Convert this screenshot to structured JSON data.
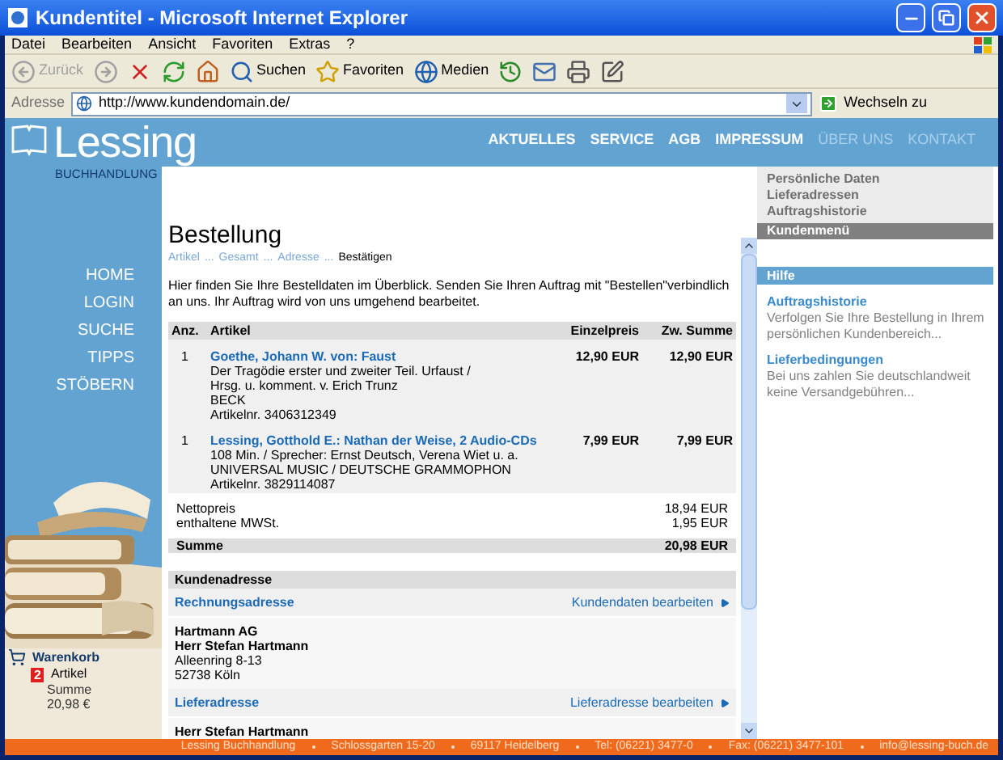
{
  "window": {
    "title": "Kundentitel - Microsoft Internet Explorer"
  },
  "menu": [
    "Datei",
    "Bearbeiten",
    "Ansicht",
    "Favoriten",
    "Extras",
    "?"
  ],
  "toolbar": [
    {
      "kind": "back",
      "label": "Zurück",
      "disabled": true
    },
    {
      "kind": "forward",
      "disabled": true
    },
    {
      "kind": "stop",
      "disabled": false
    },
    {
      "kind": "refresh",
      "disabled": false
    },
    {
      "kind": "home",
      "disabled": false
    },
    {
      "kind": "search",
      "label": "Suchen",
      "disabled": false
    },
    {
      "kind": "favorites",
      "label": "Favoriten",
      "disabled": false
    },
    {
      "kind": "media",
      "label": "Medien",
      "disabled": false
    },
    {
      "kind": "history",
      "disabled": false
    },
    {
      "kind": "mail",
      "disabled": false
    },
    {
      "kind": "print",
      "disabled": false
    },
    {
      "kind": "edit",
      "disabled": false
    }
  ],
  "address": {
    "label": "Adresse",
    "url": "http://www.kundendomain.de/",
    "go": "Wechseln zu"
  },
  "site": {
    "logo": "Lessing",
    "logo_sub": "BUCHHANDLUNG",
    "nav": [
      {
        "label": "AKTUELLES",
        "dimmed": false
      },
      {
        "label": "SERVICE",
        "dimmed": false
      },
      {
        "label": "AGB",
        "dimmed": false
      },
      {
        "label": "IMPRESSUM",
        "dimmed": false
      },
      {
        "label": "ÜBER UNS",
        "dimmed": true
      },
      {
        "label": "KONTAKT",
        "dimmed": true
      }
    ]
  },
  "side_nav": [
    "HOME",
    "LOGIN",
    "SUCHE",
    "TIPPS",
    "STÖBERN"
  ],
  "cart": {
    "title": "Warenkorb",
    "count": "2",
    "count_label": "Artikel",
    "sum_label": "Summe",
    "sum": "20,98 €"
  },
  "order": {
    "title": "Bestellung",
    "breadcrumb": [
      {
        "label": "Artikel",
        "kind": "link"
      },
      {
        "label": "...",
        "kind": "separator"
      },
      {
        "label": "Gesamt",
        "kind": "link"
      },
      {
        "label": "...",
        "kind": "separator"
      },
      {
        "label": "Adresse",
        "kind": "link"
      },
      {
        "label": "...",
        "kind": "separator"
      },
      {
        "label": "Bestätigen",
        "kind": "current"
      }
    ],
    "intro": "Hier finden Sie Ihre Bestelldaten im Überblick. Senden Sie Ihren Auftrag mit \"Bestellen\"verbindlich an uns. Ihr Auftrag wird von uns umgehend bearbeitet.",
    "columns": [
      "Anz.",
      "Artikel",
      "Einzelpreis",
      "Zw. Summe"
    ],
    "rows": [
      {
        "qty": "1",
        "title": "Goethe, Johann W. von: Faust",
        "details": [
          "Der Tragödie erster und zweiter Teil. Urfaust /",
          "Hrsg. u. komment. v. Erich Trunz",
          "BECK",
          "Artikelnr. 3406312349"
        ],
        "price": "12,90 EUR",
        "total": "12,90 EUR"
      },
      {
        "qty": "1",
        "title": "Lessing, Gotthold E.: Nathan der Weise, 2 Audio-CDs",
        "details": [
          "108 Min. / Sprecher: Ernst Deutsch, Verena Wiet u. a.",
          "UNIVERSAL MUSIC / DEUTSCHE GRAMMOPHON",
          "Artikelnr. 3829114087"
        ],
        "price": "7,99 EUR",
        "total": "7,99 EUR"
      }
    ],
    "totals": [
      {
        "label": "Nettopreis",
        "value": "18,94 EUR"
      },
      {
        "label": "enthaltene MWSt.",
        "value": "1,95 EUR"
      }
    ],
    "sum": {
      "label": "Summe",
      "value": "20,98 EUR"
    }
  },
  "customer": {
    "title": "Kundenadresse",
    "sections": [
      {
        "title": "Rechnungsadresse",
        "action": "Kundendaten bearbeiten",
        "lines": [
          {
            "text": "Hartmann AG",
            "bold": true
          },
          {
            "text": "Herr Stefan Hartmann",
            "bold": true
          },
          {
            "text": "Alleenring 8-13",
            "bold": false
          },
          {
            "text": "52738 Köln",
            "bold": false
          }
        ]
      },
      {
        "title": "Lieferadresse",
        "action": "Lieferadresse bearbeiten",
        "lines": [
          {
            "text": "Herr Stefan Hartmann",
            "bold": true
          }
        ]
      }
    ]
  },
  "account": {
    "links": [
      "Persönliche Daten",
      "Lieferadressen",
      "Auftragshistorie"
    ],
    "title": "Kundenmenü"
  },
  "help": {
    "title": "Hilfe",
    "items": [
      {
        "title": "Auftragshistorie",
        "text": "Verfolgen Sie Ihre Bestellung in Ihrem persönlichen Kundenbereich..."
      },
      {
        "title": "Lieferbedingungen",
        "text": "Bei uns zahlen Sie deutschlandweit keine Versandgebühren..."
      }
    ]
  },
  "footer": [
    "Lessing Buchhandlung",
    "Schlossgarten 15-20",
    "69117 Heidelberg",
    "Tel: (06221) 3477-0",
    "Fax: (06221) 3477-101",
    "info@lessing-buch.de"
  ]
}
